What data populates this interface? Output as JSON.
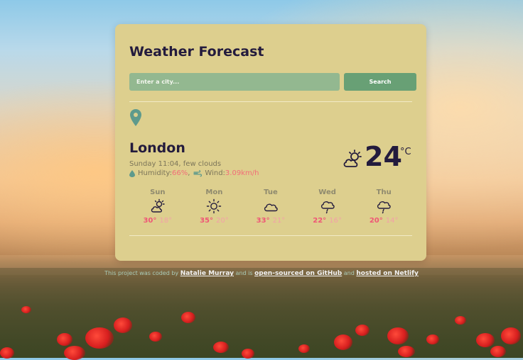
{
  "app": {
    "title": "Weather Forecast"
  },
  "search": {
    "placeholder": "Enter a city...",
    "value": "",
    "button_label": "Search"
  },
  "current": {
    "city": "London",
    "datetime": "Sunday 11:04",
    "separator": ", ",
    "condition": "few clouds",
    "humidity_label": "Humidity: ",
    "humidity_value": "66%",
    "humidity_suffix": ",",
    "wind_label": "Wind:",
    "wind_value": "3.09km/h",
    "temperature": "24",
    "unit": "°C",
    "icon": "partly-cloudy-icon"
  },
  "forecast": [
    {
      "day": "Sun",
      "icon": "partly-cloudy-icon",
      "high": "30°",
      "low": "18°"
    },
    {
      "day": "Mon",
      "icon": "sun-icon",
      "high": "35°",
      "low": "20°"
    },
    {
      "day": "Tue",
      "icon": "cloud-icon",
      "high": "33°",
      "low": "21°"
    },
    {
      "day": "Wed",
      "icon": "rain-icon",
      "high": "22°",
      "low": "16°"
    },
    {
      "day": "Thu",
      "icon": "rain-icon",
      "high": "20°",
      "low": "14°"
    }
  ],
  "footer": {
    "text1": "This project was coded by ",
    "author": "Natalie Murray",
    "text2": " and is ",
    "github": "open-sourced on GitHub",
    "text3": " and ",
    "hosting": "hosted on Netlify"
  },
  "colors": {
    "card": "#ddcf8e",
    "accent": "#f26d78",
    "button": "#68a075",
    "input": "#93b890",
    "text_dark": "#231b3d"
  }
}
